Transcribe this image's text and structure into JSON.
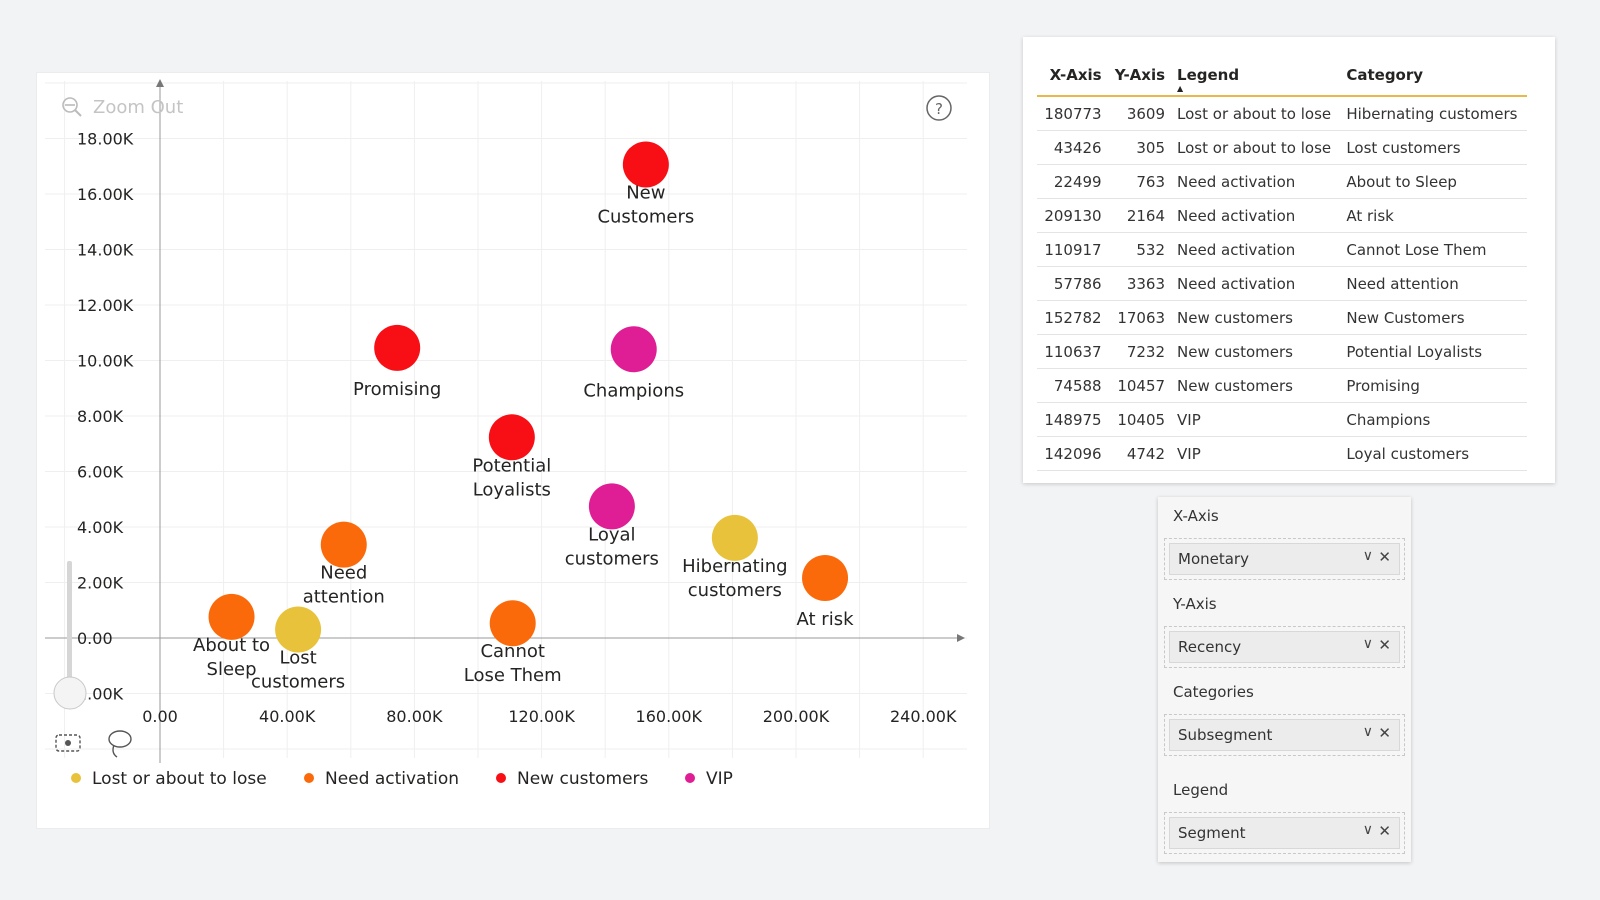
{
  "chart_data": {
    "type": "scatter",
    "xlim": [
      -75000,
      260000
    ],
    "ylim": [
      -4200,
      18000
    ],
    "x_ticks": [
      0,
      40000,
      80000,
      120000,
      160000,
      200000,
      240000
    ],
    "x_tick_labels": [
      "0.00",
      "40.00K",
      "80.00K",
      "120.00K",
      "160.00K",
      "200.00K",
      "240.00K"
    ],
    "y_ticks": [
      -2000,
      0,
      2000,
      4000,
      6000,
      8000,
      10000,
      12000,
      14000,
      16000,
      18000
    ],
    "y_tick_labels": [
      "2.00K",
      "0.00",
      "2.00K",
      "4.00K",
      "6.00K",
      "8.00K",
      "10.00K",
      "12.00K",
      "14.00K",
      "16.00K",
      "18.00K"
    ],
    "grid": true,
    "legend_position": "bottom-left",
    "series": [
      {
        "name": "Lost or about to lose",
        "color": "#e8c23a",
        "points": [
          {
            "x": 180773,
            "y": 3609,
            "label": [
              "Hibernating",
              "customers"
            ]
          },
          {
            "x": 43426,
            "y": 305,
            "label": [
              "Lost",
              "customers"
            ]
          }
        ]
      },
      {
        "name": "Need activation",
        "color": "#fb6a0a",
        "points": [
          {
            "x": 22499,
            "y": 763,
            "label": [
              "About to",
              "Sleep"
            ]
          },
          {
            "x": 209130,
            "y": 2164,
            "label": [
              "At risk"
            ]
          },
          {
            "x": 110917,
            "y": 532,
            "label": [
              "Cannot",
              "Lose Them"
            ]
          },
          {
            "x": 57786,
            "y": 3363,
            "label": [
              "Need",
              "attention"
            ]
          }
        ]
      },
      {
        "name": "New customers",
        "color": "#f70f15",
        "points": [
          {
            "x": 152782,
            "y": 17063,
            "label": [
              "New",
              "Customers"
            ]
          },
          {
            "x": 110637,
            "y": 7232,
            "label": [
              "Potential",
              "Loyalists"
            ]
          },
          {
            "x": 74588,
            "y": 10457,
            "label": [
              "Promising"
            ]
          }
        ]
      },
      {
        "name": "VIP",
        "color": "#df1d94",
        "points": [
          {
            "x": 148975,
            "y": 10405,
            "label": [
              "Champions"
            ]
          },
          {
            "x": 142096,
            "y": 4742,
            "label": [
              "Loyal",
              "customers"
            ]
          }
        ]
      }
    ]
  },
  "chart_ui": {
    "zoom_out_label": "Zoom Out",
    "help_icon": "question-circle-icon",
    "rect_select_icon": "rectangle-select-icon",
    "lasso_icon": "lasso-icon",
    "zoom_icon": "zoom-out-icon"
  },
  "table": {
    "headers": [
      "X-Axis",
      "Y-Axis",
      "Legend",
      "Category"
    ],
    "sorted_column": "Legend",
    "rows": [
      [
        "180773",
        "3609",
        "Lost or about to lose",
        "Hibernating customers"
      ],
      [
        "43426",
        "305",
        "Lost or about to lose",
        "Lost customers"
      ],
      [
        "22499",
        "763",
        "Need activation",
        "About to Sleep"
      ],
      [
        "209130",
        "2164",
        "Need activation",
        "At risk"
      ],
      [
        "110917",
        "532",
        "Need activation",
        "Cannot Lose Them"
      ],
      [
        "57786",
        "3363",
        "Need activation",
        "Need attention"
      ],
      [
        "152782",
        "17063",
        "New customers",
        "New Customers"
      ],
      [
        "110637",
        "7232",
        "New customers",
        "Potential Loyalists"
      ],
      [
        "74588",
        "10457",
        "New customers",
        "Promising"
      ],
      [
        "148975",
        "10405",
        "VIP",
        "Champions"
      ],
      [
        "142096",
        "4742",
        "VIP",
        "Loyal customers"
      ]
    ]
  },
  "fields": [
    {
      "label": "X-Axis",
      "value": "Monetary"
    },
    {
      "label": "Y-Axis",
      "value": "Recency"
    },
    {
      "label": "Categories",
      "value": "Subsegment"
    },
    {
      "label": "Legend",
      "value": "Segment"
    }
  ]
}
